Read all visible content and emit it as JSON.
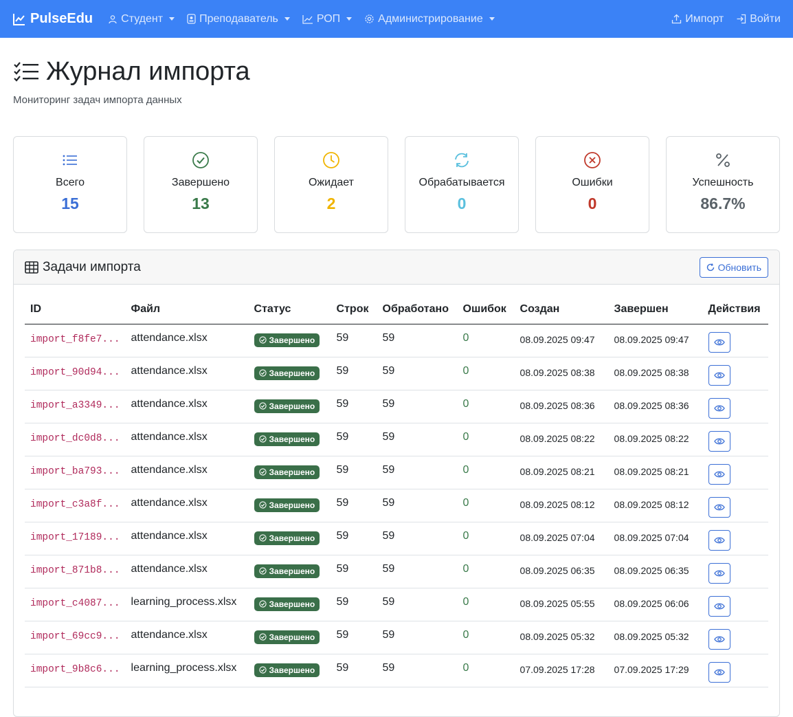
{
  "navbar": {
    "brand": "PulseEdu",
    "items": [
      {
        "label": "Студент",
        "icon": "person-icon"
      },
      {
        "label": "Преподаватель",
        "icon": "badge-icon"
      },
      {
        "label": "РОП",
        "icon": "chart-icon"
      },
      {
        "label": "Администрирование",
        "icon": "gear-icon"
      }
    ],
    "import_label": "Импорт",
    "login_label": "Войти"
  },
  "page": {
    "title": "Журнал импорта",
    "subtitle": "Мониторинг задач импорта данных"
  },
  "stats": [
    {
      "label": "Всего",
      "value": "15",
      "color": "#3b6fd6",
      "icon": "list-icon"
    },
    {
      "label": "Завершено",
      "value": "13",
      "color": "#3a7a4a",
      "icon": "check-circle-icon"
    },
    {
      "label": "Ожидает",
      "value": "2",
      "color": "#f0b400",
      "icon": "clock-icon"
    },
    {
      "label": "Обрабатывается",
      "value": "0",
      "color": "#5bc0de",
      "icon": "refresh-icon"
    },
    {
      "label": "Ошибки",
      "value": "0",
      "color": "#c0392b",
      "icon": "x-circle-icon"
    },
    {
      "label": "Успешность",
      "value": "86.7%",
      "color": "#5a6268",
      "icon": "percent-icon"
    }
  ],
  "tasks": {
    "title": "Задачи импорта",
    "refresh_label": "Обновить",
    "columns": [
      "ID",
      "Файл",
      "Статус",
      "Строк",
      "Обработано",
      "Ошибок",
      "Создан",
      "Завершен",
      "Действия"
    ],
    "rows": [
      {
        "id": "import_f8fe7...",
        "file": "attendance.xlsx",
        "status": "Завершено",
        "rows": "59",
        "processed": "59",
        "errors": "0",
        "created": "08.09.2025 09:47",
        "finished": "08.09.2025 09:47"
      },
      {
        "id": "import_90d94...",
        "file": "attendance.xlsx",
        "status": "Завершено",
        "rows": "59",
        "processed": "59",
        "errors": "0",
        "created": "08.09.2025 08:38",
        "finished": "08.09.2025 08:38"
      },
      {
        "id": "import_a3349...",
        "file": "attendance.xlsx",
        "status": "Завершено",
        "rows": "59",
        "processed": "59",
        "errors": "0",
        "created": "08.09.2025 08:36",
        "finished": "08.09.2025 08:36"
      },
      {
        "id": "import_dc0d8...",
        "file": "attendance.xlsx",
        "status": "Завершено",
        "rows": "59",
        "processed": "59",
        "errors": "0",
        "created": "08.09.2025 08:22",
        "finished": "08.09.2025 08:22"
      },
      {
        "id": "import_ba793...",
        "file": "attendance.xlsx",
        "status": "Завершено",
        "rows": "59",
        "processed": "59",
        "errors": "0",
        "created": "08.09.2025 08:21",
        "finished": "08.09.2025 08:21"
      },
      {
        "id": "import_c3a8f...",
        "file": "attendance.xlsx",
        "status": "Завершено",
        "rows": "59",
        "processed": "59",
        "errors": "0",
        "created": "08.09.2025 08:12",
        "finished": "08.09.2025 08:12"
      },
      {
        "id": "import_17189...",
        "file": "attendance.xlsx",
        "status": "Завершено",
        "rows": "59",
        "processed": "59",
        "errors": "0",
        "created": "08.09.2025 07:04",
        "finished": "08.09.2025 07:04"
      },
      {
        "id": "import_871b8...",
        "file": "attendance.xlsx",
        "status": "Завершено",
        "rows": "59",
        "processed": "59",
        "errors": "0",
        "created": "08.09.2025 06:35",
        "finished": "08.09.2025 06:35"
      },
      {
        "id": "import_c4087...",
        "file": "learning_process.xlsx",
        "status": "Завершено",
        "rows": "59",
        "processed": "59",
        "errors": "0",
        "created": "08.09.2025 05:55",
        "finished": "08.09.2025 06:06"
      },
      {
        "id": "import_69cc9...",
        "file": "attendance.xlsx",
        "status": "Завершено",
        "rows": "59",
        "processed": "59",
        "errors": "0",
        "created": "08.09.2025 05:32",
        "finished": "08.09.2025 05:32"
      },
      {
        "id": "import_9b8c6...",
        "file": "learning_process.xlsx",
        "status": "Завершено",
        "rows": "59",
        "processed": "59",
        "errors": "0",
        "created": "07.09.2025 17:28",
        "finished": "07.09.2025 17:29"
      }
    ]
  }
}
